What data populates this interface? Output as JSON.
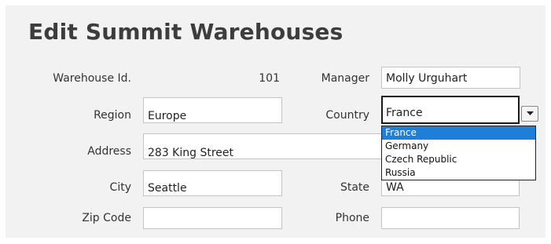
{
  "page": {
    "title": "Edit Summit Warehouses"
  },
  "form": {
    "warehouse_id": {
      "label": "Warehouse Id.",
      "value": "101"
    },
    "manager": {
      "label": "Manager",
      "value": "Molly Urguhart"
    },
    "region": {
      "label": "Region",
      "value": "Europe"
    },
    "country": {
      "label": "Country",
      "value": "France",
      "options": [
        "France",
        "Germany",
        "Czech Republic",
        "Russia"
      ],
      "selected_index": 0,
      "expanded": true
    },
    "address": {
      "label": "Address",
      "value": "283 King Street"
    },
    "city": {
      "label": "City",
      "value": "Seattle"
    },
    "state": {
      "label": "State",
      "value": "WA"
    },
    "zip": {
      "label": "Zip Code",
      "value": ""
    },
    "phone": {
      "label": "Phone",
      "value": ""
    }
  },
  "icons": {
    "dropdown": "chevron-down-icon"
  },
  "colors": {
    "selection": "#1f7fd8",
    "panel": "#f2f2f2",
    "title": "#3d3d3d"
  }
}
